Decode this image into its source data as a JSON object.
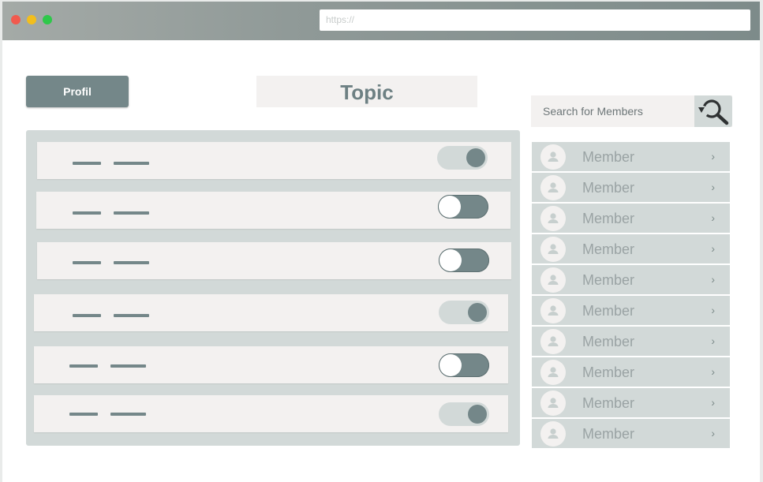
{
  "browser": {
    "url_placeholder": "https://"
  },
  "header": {
    "profil_label": "Profil",
    "topic_title": "Topic"
  },
  "settings": {
    "rows": [
      {
        "toggle": "on"
      },
      {
        "toggle": "off"
      },
      {
        "toggle": "off"
      },
      {
        "toggle": "on"
      },
      {
        "toggle": "off"
      },
      {
        "toggle": "on"
      }
    ]
  },
  "search": {
    "placeholder": "Search for Members",
    "icon": "search-refresh-icon"
  },
  "members": {
    "items": [
      {
        "label": "Member",
        "icon": "user-avatar-icon"
      },
      {
        "label": "Member",
        "icon": "user-avatar-icon"
      },
      {
        "label": "Member",
        "icon": "user-avatar-icon"
      },
      {
        "label": "Member",
        "icon": "user-avatar-icon"
      },
      {
        "label": "Member",
        "icon": "user-avatar-icon"
      },
      {
        "label": "Member",
        "icon": "user-avatar-icon"
      },
      {
        "label": "Member",
        "icon": "user-avatar-icon"
      },
      {
        "label": "Member",
        "icon": "user-avatar-icon"
      },
      {
        "label": "Member",
        "icon": "user-avatar-icon"
      },
      {
        "label": "Member",
        "icon": "user-avatar-icon"
      }
    ]
  },
  "colors": {
    "accent": "#748789",
    "panel": "#d2d9d8",
    "card": "#f3f1f0"
  }
}
